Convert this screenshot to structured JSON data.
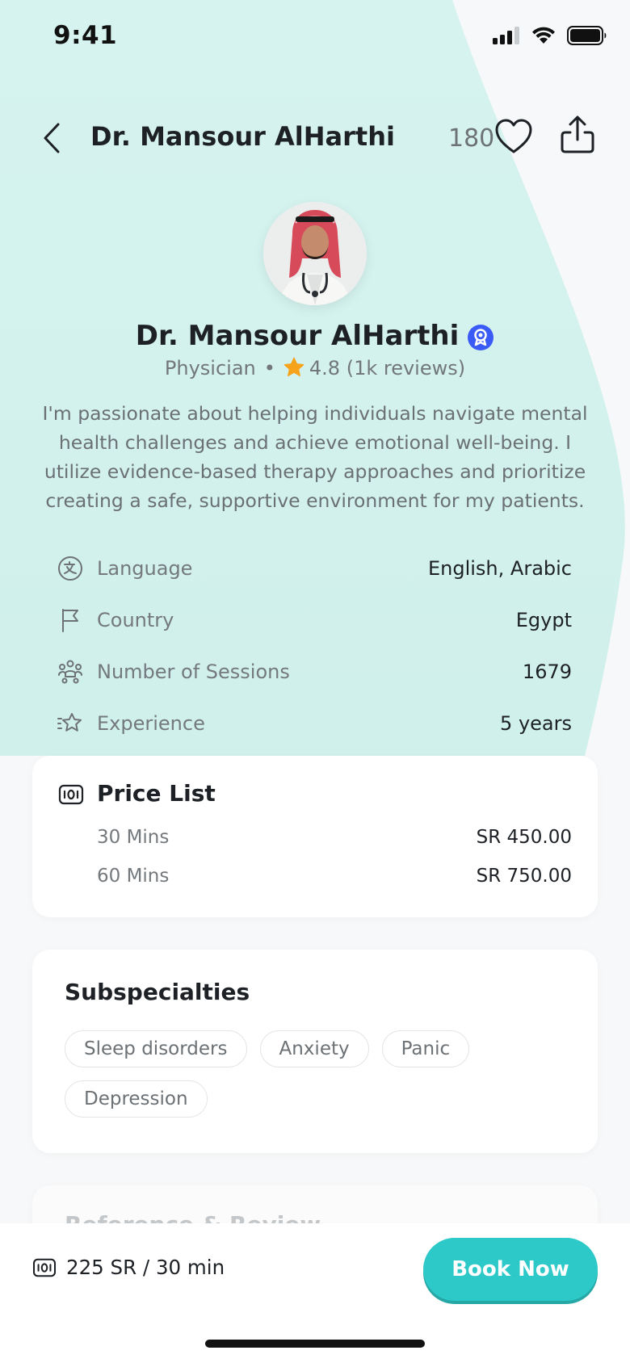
{
  "status_bar": {
    "time": "9:41"
  },
  "nav": {
    "title": "Dr. Mansour AlHarthi",
    "favorites_count": "180"
  },
  "profile": {
    "name": "Dr. Mansour AlHarthi",
    "specialty": "Physician",
    "rating": "4.8",
    "reviews": "(1k reviews)",
    "bio": "I'm passionate about helping individuals navigate mental health challenges and achieve emotional well-being. I utilize evidence-based therapy approaches and prioritize creating a safe, supportive environment for my patients."
  },
  "info": [
    {
      "icon": "language-icon",
      "label": "Language",
      "value": "English, Arabic"
    },
    {
      "icon": "flag-icon",
      "label": "Country",
      "value": "Egypt"
    },
    {
      "icon": "people-icon",
      "label": "Number of Sessions",
      "value": "1679"
    },
    {
      "icon": "star-outline-icon",
      "label": "Experience",
      "value": "5 years"
    }
  ],
  "price_list": {
    "title": "Price List",
    "items": [
      {
        "label": "30 Mins",
        "value": "SR 450.00"
      },
      {
        "label": "60 Mins",
        "value": "SR 750.00"
      }
    ]
  },
  "subspecialties": {
    "title": "Subspecialties",
    "chips": [
      "Sleep disorders",
      "Anxiety",
      "Panic",
      "Depression"
    ]
  },
  "next_section": {
    "title": "Reference & Review"
  },
  "bottom_bar": {
    "price": "225 SR / 30 min",
    "book_label": "Book Now"
  },
  "colors": {
    "accent": "#2cc9c8",
    "mint_bg": "#d4f2ee",
    "verified": "#3b5bf6",
    "star": "#f6a21b"
  }
}
